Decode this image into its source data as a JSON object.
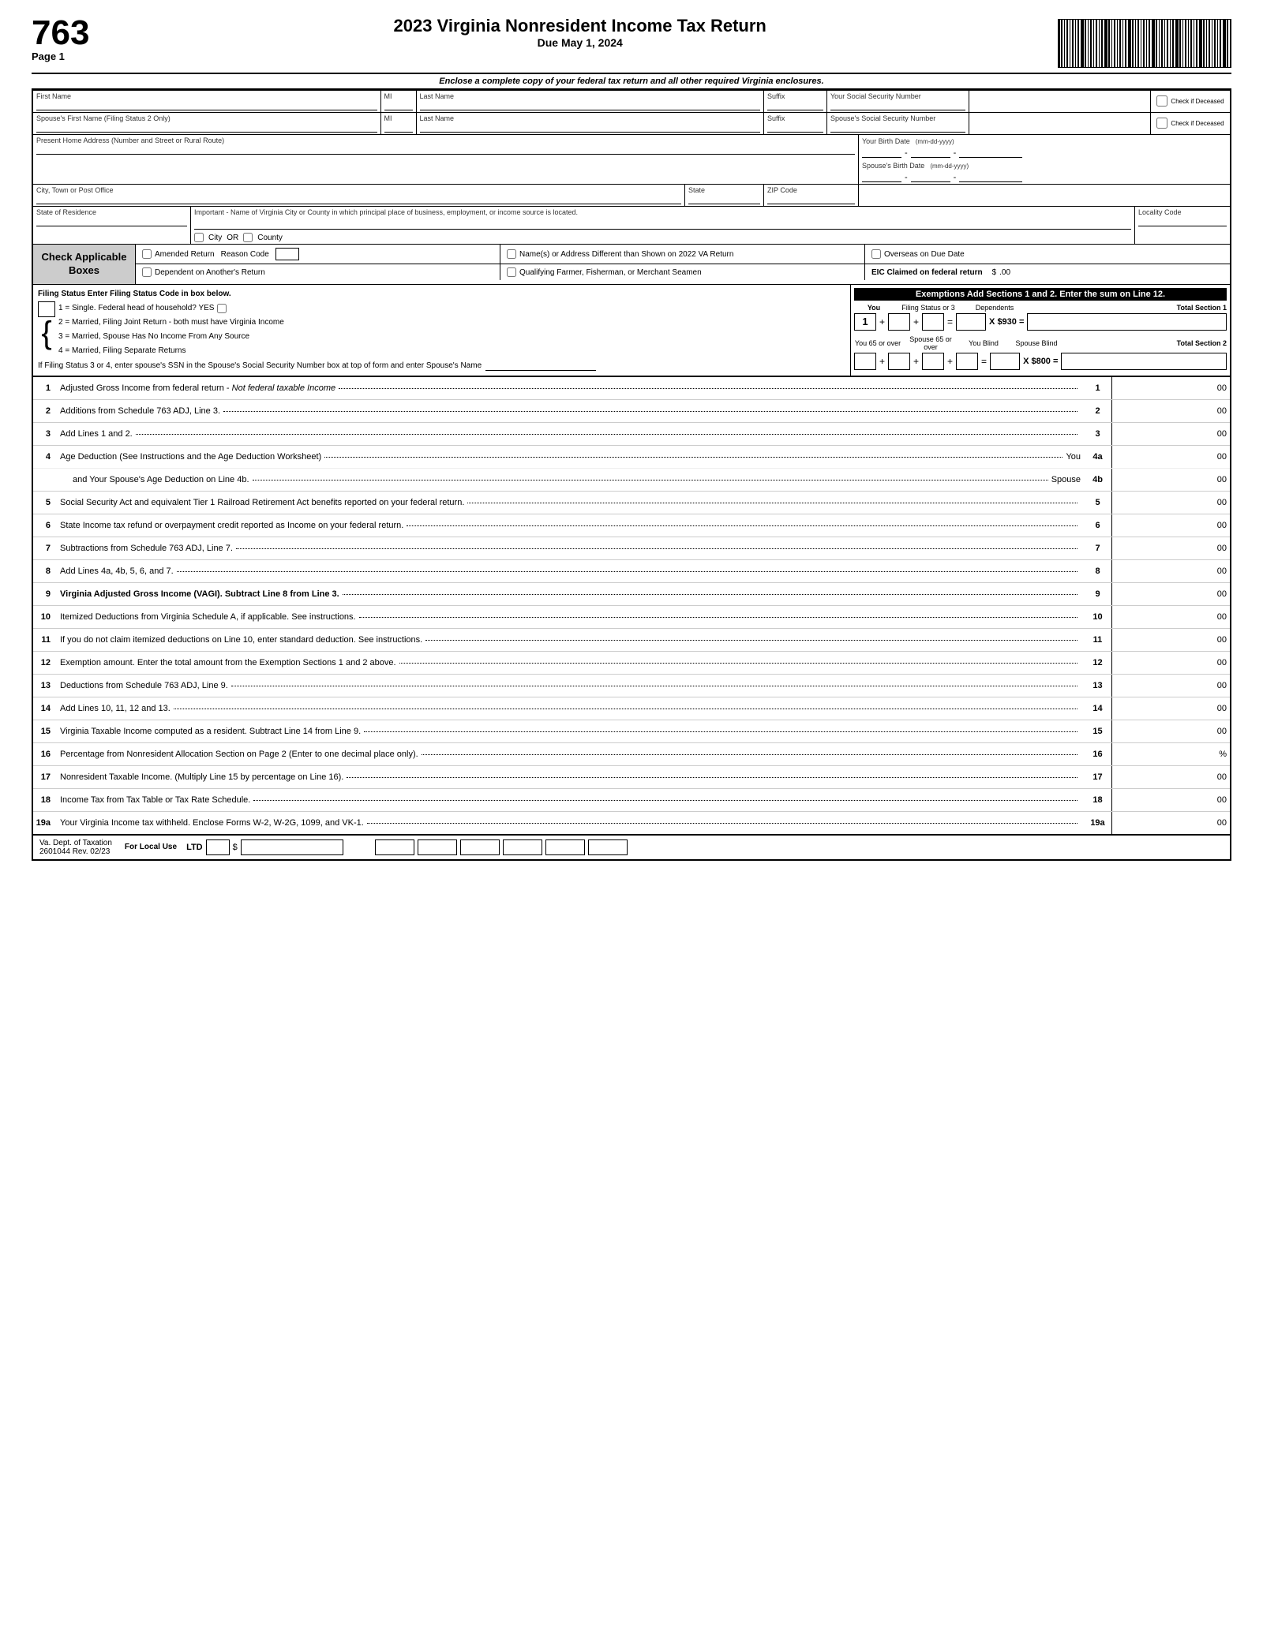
{
  "header": {
    "form_number": "763",
    "page_label": "Page 1",
    "title": "2023 Virginia Nonresident Income Tax Return",
    "due_date": "Due May 1, 2024"
  },
  "enclosure_notice": "Enclose a complete copy of your federal tax return and all other required Virginia enclosures.",
  "fields": {
    "first_name_label": "First Name",
    "mi_label": "MI",
    "last_name_label": "Last Name",
    "suffix_label": "Suffix",
    "ssn_label": "Your Social Security Number",
    "check_deceased_label": "Check if Deceased",
    "spouse_first_name_label": "Spouse's First Name (Filing Status 2 Only)",
    "spouse_ssn_label": "Spouse's Social Security Number",
    "address_label": "Present Home Address (Number and Street or Rural Route)",
    "your_birth_date_label": "Your Birth Date",
    "birth_date_format": "(mm-dd-yyyy)",
    "city_label": "City, Town or Post Office",
    "state_label": "State",
    "zip_label": "ZIP Code",
    "spouse_birth_date_label": "Spouse's Birth Date",
    "state_of_residence_label": "State of Residence",
    "va_city_county_label": "Important - Name of Virginia City or County in which principal place of business, employment, or income source is located.",
    "locality_code_label": "Locality Code",
    "city_label2": "City",
    "or_label": "OR",
    "county_label": "County"
  },
  "check_applicable": {
    "label": "Check Applicable Boxes",
    "amended_return_label": "Amended Return",
    "reason_code_label": "Reason Code",
    "name_address_diff_label": "Name(s) or Address Different than Shown on 2022 VA Return",
    "overseas_due_date_label": "Overseas on Due Date",
    "dependent_label": "Dependent on Another's Return",
    "qualifying_farmer_label": "Qualifying Farmer, Fisherman, or Merchant Seamen",
    "eic_label": "EIC Claimed on federal return",
    "eic_amount": ".00"
  },
  "filing_status": {
    "header": "Filing Status Enter Filing Status Code in box below.",
    "code_1": "1 = Single. Federal head of household? YES",
    "code_2": "2 = Married, Filing Joint Return - both must have Virginia Income",
    "code_3": "3 = Married, Spouse Has No Income From Any Source",
    "code_4": "4 = Married, Filing Separate Returns",
    "ssn_note": "If Filing Status 3 or 4, enter spouse's SSN in the Spouse's Social Security Number box at top of form and enter Spouse's Name"
  },
  "exemptions": {
    "header": "Exemptions Add Sections 1 and 2. Enter the sum on Line 12.",
    "you_label": "You",
    "filing_status_label": "Filing Status or 3",
    "dependents_label": "Dependents",
    "total_section1_label": "Total Section 1",
    "multiplier1": "X $930 =",
    "you_65_label": "You 65 or over",
    "spouse_65_label": "Spouse 65 or over",
    "you_blind_label": "You Blind",
    "spouse_blind_label": "Spouse Blind",
    "total_section2_label": "Total Section 2",
    "multiplier2": "X $800 =",
    "section1_value": "1"
  },
  "lines": [
    {
      "num": "1",
      "desc": "Adjusted Gross Income from federal return - ",
      "desc_italic": "Not federal taxable Income",
      "dots": true,
      "ref": "1",
      "cents": "00"
    },
    {
      "num": "2",
      "desc": "Additions from Schedule 763 ADJ, Line 3.",
      "dots": true,
      "ref": "2",
      "cents": "00"
    },
    {
      "num": "3",
      "desc": "Add Lines 1 and 2.",
      "dots": true,
      "ref": "3",
      "cents": "00"
    },
    {
      "num": "4",
      "desc": "Age Deduction (See Instructions and the Age Deduction Worksheet)",
      "desc_suffix": " You",
      "dots": true,
      "ref": "4a",
      "cents": "00",
      "subline": {
        "desc": "and Your Spouse's Age Deduction on Line 4b.",
        "desc_suffix": " Spouse",
        "dots": true,
        "ref": "4b",
        "cents": "00"
      }
    },
    {
      "num": "5",
      "desc": "Social Security Act and equivalent Tier 1 Railroad Retirement Act benefits reported on your federal return.",
      "dots": true,
      "ref": "5",
      "cents": "00"
    },
    {
      "num": "6",
      "desc": "State Income tax refund or overpayment credit reported as Income on your federal return.",
      "dots": true,
      "ref": "6",
      "cents": "00"
    },
    {
      "num": "7",
      "desc": "Subtractions from Schedule 763 ADJ, Line 7.",
      "dots": true,
      "ref": "7",
      "cents": "00"
    },
    {
      "num": "8",
      "desc": "Add Lines 4a, 4b, 5, 6, and 7.",
      "dots": true,
      "ref": "8",
      "cents": "00"
    },
    {
      "num": "9",
      "desc": "Virginia Adjusted Gross Income (VAGI). Subtract Line 8 from Line 3.",
      "bold": true,
      "dots": true,
      "ref": "9",
      "cents": "00"
    },
    {
      "num": "10",
      "desc": "Itemized Deductions from Virginia Schedule A, if applicable. See instructions.",
      "dots": true,
      "ref": "10",
      "cents": "00"
    },
    {
      "num": "11",
      "desc": "If you do not claim itemized deductions on Line 10, enter standard deduction. See instructions.",
      "dots": true,
      "ref": "11",
      "cents": "00"
    },
    {
      "num": "12",
      "desc": "Exemption amount. Enter the total amount from the Exemption Sections 1 and 2 above.",
      "dots": true,
      "ref": "12",
      "cents": "00"
    },
    {
      "num": "13",
      "desc": "Deductions from Schedule 763 ADJ, Line 9.",
      "dots": true,
      "ref": "13",
      "cents": "00"
    },
    {
      "num": "14",
      "desc": "Add Lines 10, 11, 12 and 13.",
      "dots": true,
      "ref": "14",
      "cents": "00"
    },
    {
      "num": "15",
      "desc": "Virginia Taxable Income computed as a resident. Subtract Line 14 from Line 9.",
      "dots": true,
      "ref": "15",
      "cents": "00"
    },
    {
      "num": "16",
      "desc": "Percentage from Nonresident Allocation Section on Page 2 (Enter to one decimal place only).",
      "dots": true,
      "ref": "16",
      "cents": "%"
    },
    {
      "num": "17",
      "desc": "Nonresident Taxable Income. (Multiply Line 15 by percentage on Line 16).",
      "dots": true,
      "ref": "17",
      "cents": "00"
    },
    {
      "num": "18",
      "desc": "Income Tax from Tax Table or Tax Rate Schedule.",
      "dots": true,
      "ref": "18",
      "cents": "00"
    },
    {
      "num": "19a",
      "desc": "Your Virginia Income tax withheld. Enclose Forms W-2, W-2G, 1099, and VK-1.",
      "dots": true,
      "ref": "19a",
      "cents": "00"
    }
  ],
  "footer": {
    "dept": "Va. Dept. of Taxation",
    "form_id": "2601044  Rev. 02/23",
    "local_use_label": "For Local Use",
    "ltd_label": "LTD",
    "dollar_sign": "$"
  }
}
